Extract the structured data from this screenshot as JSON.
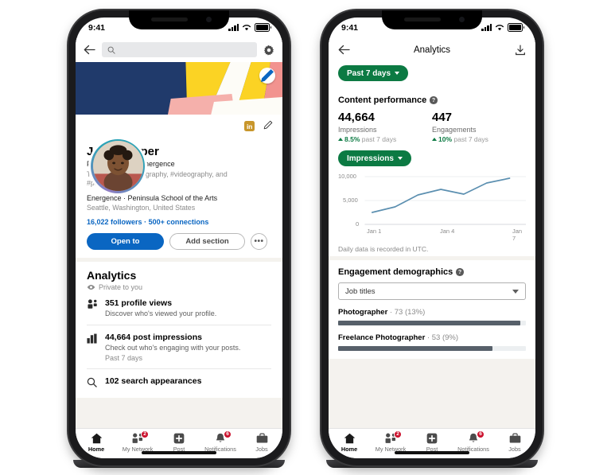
{
  "colors": {
    "linkedin_blue": "#0a66c2",
    "green": "#0c7a43",
    "badge_red": "#cb112d",
    "chart_line": "#5b8fb0",
    "bar_fill": "#57606a",
    "cover_navy": "#1d3461",
    "cover_yellow": "#fbd324",
    "cover_pink": "#f2938f"
  },
  "left_phone": {
    "status": {
      "time": "9:41",
      "signal_icon": "signal-bars-icon",
      "wifi_icon": "wifi-icon",
      "battery_icon": "battery-icon"
    },
    "topbar": {
      "back_icon": "back-arrow-icon",
      "search_icon": "search-icon",
      "search_value": "",
      "search_placeholder": "",
      "settings_icon": "gear-icon"
    },
    "cover": {
      "edit_icon": "pencil-edit-icon"
    },
    "profile": {
      "linkedin_badge": "in",
      "edit_icon": "pencil-icon",
      "name": "Jane Cooper",
      "headline": "Photographer at Energence",
      "talks_about": "Talks about #photography, #videography, and #photographer",
      "organizations": "Energence · Peninsula School of the Arts",
      "location": "Seattle, Washington, United States",
      "followers": "16,022 followers",
      "separator": "·",
      "connections": "500+ connections",
      "open_to_label": "Open to",
      "add_section_label": "Add section",
      "more_label": "•••"
    },
    "analytics": {
      "title": "Analytics",
      "privacy_icon": "eye-icon",
      "privacy": "Private to you",
      "items": [
        {
          "icon": "people-icon",
          "headline": "351 profile views",
          "description": "Discover who's viewed your profile.",
          "meta": ""
        },
        {
          "icon": "bar-chart-icon",
          "headline": "44,664 post impressions",
          "description": "Check out who's engaging with your posts.",
          "meta": "Past 7 days"
        },
        {
          "icon": "search-icon",
          "headline": "102 search appearances",
          "description": "",
          "meta": ""
        }
      ]
    }
  },
  "right_phone": {
    "status": {
      "time": "9:41",
      "signal_icon": "signal-bars-icon",
      "wifi_icon": "wifi-icon",
      "battery_icon": "battery-icon"
    },
    "navbar": {
      "back_icon": "back-arrow-icon",
      "title": "Analytics",
      "download_icon": "download-icon"
    },
    "filter": {
      "label": "Past 7 days",
      "caret_icon": "chevron-down-icon"
    },
    "content_performance": {
      "title": "Content performance",
      "help_icon": "help-icon",
      "metrics": [
        {
          "value": "44,664",
          "label": "Impressions",
          "delta": "8.5%",
          "delta_period": "past 7 days",
          "trend_icon": "trend-up-icon"
        },
        {
          "value": "447",
          "label": "Engagements",
          "delta": "10%",
          "delta_period": "past 7 days",
          "trend_icon": "trend-up-icon"
        }
      ],
      "metric_selector": {
        "label": "Impressions",
        "caret_icon": "chevron-down-icon"
      },
      "footnote": "Daily data is recorded in UTC."
    },
    "demographics": {
      "title": "Engagement demographics",
      "help_icon": "help-icon",
      "dropdown_value": "Job titles",
      "dropdown_icon": "chevron-down-icon",
      "rows": [
        {
          "label": "Photographer",
          "separator": "·",
          "count": "73",
          "percent": "(13%)",
          "bar_pct": 97
        },
        {
          "label": "Freelance Photographer",
          "separator": "·",
          "count": "53",
          "percent": "(9%)",
          "bar_pct": 82
        }
      ]
    }
  },
  "chart_data": {
    "type": "line",
    "title": "Impressions",
    "xlabel": "",
    "ylabel": "",
    "x": [
      "Jan 1",
      "Jan 2",
      "Jan 3",
      "Jan 4",
      "Jan 5",
      "Jan 6",
      "Jan 7"
    ],
    "xtick_labels": [
      "Jan 1",
      "Jan 4",
      "Jan 7"
    ],
    "ytick_labels": [
      "0",
      "5,000",
      "10,000"
    ],
    "ylim": [
      0,
      10000
    ],
    "values": [
      2500,
      3700,
      6200,
      7300,
      6300,
      8500,
      9500
    ],
    "grid": true,
    "legend": "none",
    "line_color": "#5b8fb0",
    "note": "Daily data is recorded in UTC."
  },
  "tabbar": {
    "items": [
      {
        "icon": "home-icon",
        "label": "Home",
        "badge": "",
        "active": true
      },
      {
        "icon": "network-icon",
        "label": "My Network",
        "badge": "2",
        "active": false
      },
      {
        "icon": "post-icon",
        "label": "Post",
        "badge": "",
        "active": false
      },
      {
        "icon": "bell-icon",
        "label": "Notifications",
        "badge": "6",
        "active": false
      },
      {
        "icon": "briefcase-icon",
        "label": "Jobs",
        "badge": "",
        "active": false
      }
    ]
  }
}
